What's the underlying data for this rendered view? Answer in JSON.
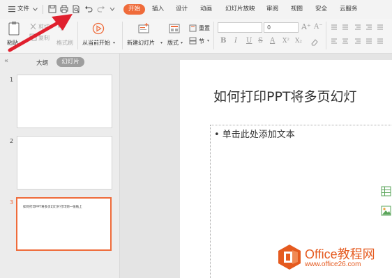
{
  "menubar": {
    "file_menu": "文件",
    "tabs": [
      {
        "label": "开始"
      },
      {
        "label": "插入"
      },
      {
        "label": "设计"
      },
      {
        "label": "动画"
      },
      {
        "label": "幻灯片放映"
      },
      {
        "label": "审阅"
      },
      {
        "label": "视图"
      },
      {
        "label": "安全"
      },
      {
        "label": "云服务"
      }
    ]
  },
  "ribbon": {
    "paste": "粘贴",
    "cut": "剪切",
    "copy": "复制",
    "format_painter": "格式刷",
    "from_current": "从当前开始",
    "new_slide": "新建幻灯片",
    "layout": "版式",
    "reset": "重置",
    "section": "节",
    "font_size_value": "0",
    "font_icons": [
      "B",
      "I",
      "U",
      "S",
      "A"
    ]
  },
  "panel": {
    "tab_outline": "大纲",
    "tab_slides": "幻灯片",
    "slides": [
      {
        "number": "1",
        "text": ""
      },
      {
        "number": "2",
        "text": ""
      },
      {
        "number": "3",
        "text": "如何打印PPT将多页幻灯片打印到一张纸上"
      }
    ]
  },
  "slide": {
    "title": "如何打印PPT将多页幻灯",
    "content_placeholder": "• 单击此处添加文本"
  },
  "watermark": {
    "title": "Office教程网",
    "url": "www.office26.com"
  },
  "colors": {
    "accent": "#ef6b3a",
    "arrow": "#e0202e",
    "watermark": "#e55a1f"
  }
}
